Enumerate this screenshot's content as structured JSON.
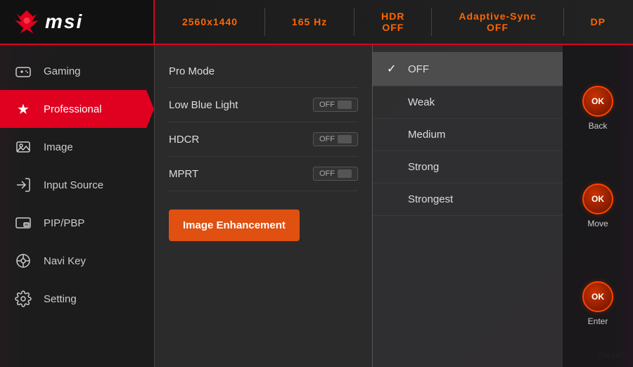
{
  "logo": {
    "brand": "msi"
  },
  "topbar": {
    "resolution": "2560x1440",
    "refresh_rate": "165 Hz",
    "hdr_label": "HDR",
    "hdr_status": "OFF",
    "adaptive_sync_label": "Adaptive-Sync",
    "adaptive_sync_status": "OFF",
    "port": "DP"
  },
  "sidebar": {
    "items": [
      {
        "id": "gaming",
        "label": "Gaming",
        "icon": "🎮",
        "active": false
      },
      {
        "id": "professional",
        "label": "Professional",
        "icon": "★",
        "active": true
      },
      {
        "id": "image",
        "label": "Image",
        "icon": "🖼",
        "active": false
      },
      {
        "id": "input-source",
        "label": "Input Source",
        "icon": "↩",
        "active": false
      },
      {
        "id": "pip-pbp",
        "label": "PIP/PBP",
        "icon": "▬",
        "active": false
      },
      {
        "id": "navi-key",
        "label": "Navi Key",
        "icon": "🎮",
        "active": false
      },
      {
        "id": "setting",
        "label": "Setting",
        "icon": "⚙",
        "active": false
      }
    ]
  },
  "middle_panel": {
    "items": [
      {
        "id": "pro-mode",
        "label": "Pro Mode",
        "has_toggle": false,
        "is_active_btn": false
      },
      {
        "id": "low-blue-light",
        "label": "Low Blue Light",
        "has_toggle": true,
        "toggle_state": "OFF",
        "is_active_btn": false
      },
      {
        "id": "hdcr",
        "label": "HDCR",
        "has_toggle": true,
        "toggle_state": "OFF",
        "is_active_btn": false
      },
      {
        "id": "mprt",
        "label": "MPRT",
        "has_toggle": true,
        "toggle_state": "OFF",
        "is_active_btn": false
      },
      {
        "id": "image-enhancement",
        "label": "Image Enhancement",
        "has_toggle": false,
        "is_active_btn": true
      }
    ]
  },
  "right_panel": {
    "options": [
      {
        "id": "off",
        "label": "OFF",
        "selected": true
      },
      {
        "id": "weak",
        "label": "Weak",
        "selected": false
      },
      {
        "id": "medium",
        "label": "Medium",
        "selected": false
      },
      {
        "id": "strong",
        "label": "Strong",
        "selected": false
      },
      {
        "id": "strongest",
        "label": "Strongest",
        "selected": false
      }
    ]
  },
  "controls": [
    {
      "id": "back",
      "label": "Back"
    },
    {
      "id": "move",
      "label": "Move"
    },
    {
      "id": "enter",
      "label": "Enter"
    }
  ],
  "firmware": "FW.107"
}
